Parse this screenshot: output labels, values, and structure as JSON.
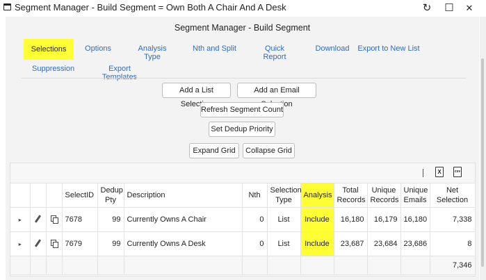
{
  "window": {
    "title": "Segment Manager - Build Segment = Own Both A Chair And A Desk",
    "refresh_glyph": "↻",
    "maximize_glyph": "☐",
    "close_glyph": "✕"
  },
  "page_title": "Segment Manager - Build Segment",
  "tabs": [
    {
      "label": "Selections",
      "active": true
    },
    {
      "label": "Options"
    },
    {
      "label": "Analysis Type"
    },
    {
      "label": "Nth and Split"
    },
    {
      "label": "Quick Report"
    },
    {
      "label": "Download"
    },
    {
      "label": "Export to New List"
    },
    {
      "label": "Suppression"
    },
    {
      "label": "Export Templates"
    }
  ],
  "buttons": {
    "add_list_selection": "Add a List Selection",
    "add_email_selection": "Add an Email Selection",
    "refresh_segment_count": "Refresh Segment Count",
    "set_dedup_priority": "Set Dedup Priority",
    "expand_grid": "Expand Grid",
    "collapse_grid": "Collapse Grid"
  },
  "grid": {
    "toolbar": {
      "xls_icon": "X",
      "csv_icon": "csv"
    },
    "columns": {
      "select_id": "SelectID",
      "dedup_pty": "Dedup Pty",
      "description": "Description",
      "nth": "Nth",
      "selection_type": "Selection Type",
      "analysis": "Analysis",
      "total_records": "Total Records",
      "unique_records": "Unique Records",
      "unique_emails": "Unique Emails",
      "net_selection": "Net Selection"
    },
    "rows": [
      {
        "expander": "▸",
        "select_id": "7678",
        "dedup_pty": "99",
        "description": "Currently Owns A Chair",
        "nth": "0",
        "selection_type": "List",
        "analysis": "Include",
        "total_records": "16,180",
        "unique_records": "16,179",
        "unique_emails": "16,180",
        "net_selection": "7,338"
      },
      {
        "expander": "▸",
        "select_id": "7679",
        "dedup_pty": "99",
        "description": "Currently Owns A Desk",
        "nth": "0",
        "selection_type": "List",
        "analysis": "Include",
        "total_records": "23,687",
        "unique_records": "23,684",
        "unique_emails": "23,686",
        "net_selection": "8"
      }
    ],
    "footer": {
      "net_selection_total": "7,346"
    }
  },
  "colors": {
    "highlight": "#ffff33",
    "tab_link": "#2f6db5"
  }
}
